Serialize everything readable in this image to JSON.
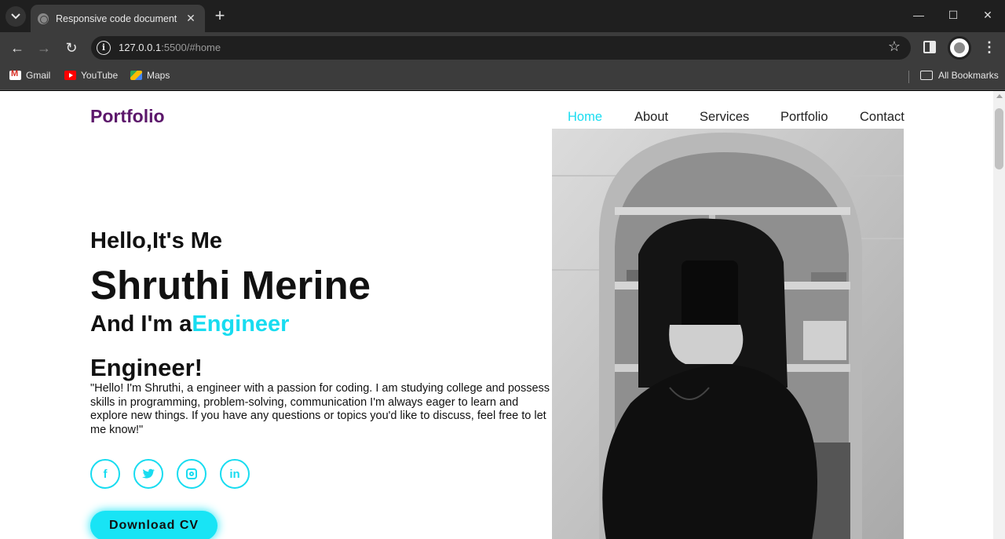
{
  "browser": {
    "tab_title": "Responsive code document",
    "url_host": "127.0.0.1",
    "url_rest": ":5500/#home",
    "bookmarks": [
      {
        "label": "Gmail",
        "icon": "gmail-icon"
      },
      {
        "label": "YouTube",
        "icon": "youtube-icon"
      },
      {
        "label": "Maps",
        "icon": "maps-icon"
      }
    ],
    "all_bookmarks_label": "All Bookmarks"
  },
  "page": {
    "logo": "Portfolio",
    "nav": [
      {
        "label": "Home",
        "active": true
      },
      {
        "label": "About",
        "active": false
      },
      {
        "label": "Services",
        "active": false
      },
      {
        "label": "Portfolio",
        "active": false
      },
      {
        "label": "Contact",
        "active": false
      }
    ],
    "hero": {
      "greeting": "Hello,It's Me",
      "name": "Shruthi Merine",
      "role_prefix": "And I'm a",
      "role_accent": "Engineer",
      "subheading": "Engineer!",
      "about": "\"Hello! I'm Shruthi, a engineer with a passion for coding. I am studying college and possess skills in programming, problem-solving, communication I'm always eager to learn and explore new things. If you have any questions or topics you'd like to discuss, feel free to let me know!\"",
      "social": [
        "facebook-icon",
        "twitter-icon",
        "instagram-icon",
        "linkedin-icon"
      ],
      "cv_button": "Download CV"
    }
  },
  "colors": {
    "accent": "#18dcf0",
    "logo": "#5c176b",
    "text": "#111111"
  }
}
